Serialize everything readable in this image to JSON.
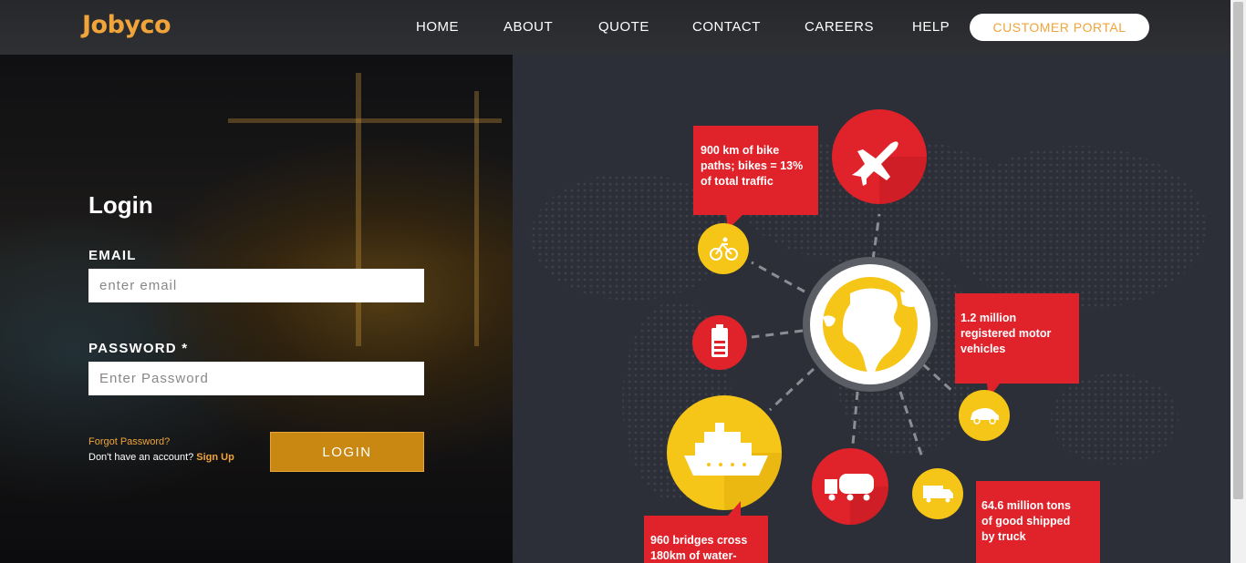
{
  "header": {
    "logo_text": "Jobyco",
    "nav": [
      {
        "label": "HOME"
      },
      {
        "label": "ABOUT"
      },
      {
        "label": "QUOTE"
      },
      {
        "label": "CONTACT"
      },
      {
        "label": "CAREERS"
      },
      {
        "label": "HELP"
      }
    ],
    "portal_label": "CUSTOMER PORTAL"
  },
  "login": {
    "title": "Login",
    "email_label": "EMAIL",
    "email_placeholder": "enter email",
    "password_label": "PASSWORD *",
    "password_placeholder": "Enter Password",
    "forgot_label": "Forgot Password?",
    "no_account_text": "Don't have an account?",
    "signup_label": "Sign Up",
    "login_button": "LOGIN"
  },
  "infographic": {
    "callouts": {
      "bike": [
        "900 km of bike",
        "paths; bikes = 13%",
        "of total traffic"
      ],
      "vehicles": [
        "1.2 million",
        "registered motor",
        "vehicles"
      ],
      "truck": [
        "64.6 million tons",
        "of good shipped",
        "by truck"
      ],
      "bridges": [
        "960 bridges cross",
        "180km of water-"
      ]
    },
    "colors": {
      "red": "#e0222b",
      "yellow": "#f5c518",
      "dark": "#2c2f37"
    }
  },
  "colors": {
    "accent": "#f0a43a",
    "button": "#c98812"
  }
}
